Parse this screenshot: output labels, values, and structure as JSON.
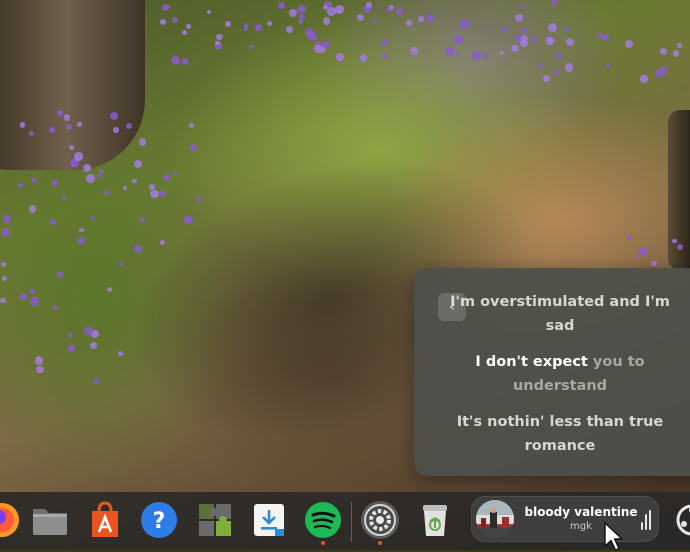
{
  "lyrics": {
    "lines": [
      {
        "text": "I'm overstimulated and I'm sad",
        "state": "past"
      },
      {
        "sung": "I don't expect",
        "unsung": " you to understand",
        "state": "current"
      },
      {
        "text": "It's nothin' less than true romance",
        "state": "next"
      }
    ],
    "collapse_icon": "chevron-left-icon"
  },
  "dock": {
    "apps": [
      {
        "name": "Firefox",
        "icon": "firefox-icon"
      },
      {
        "name": "Files",
        "icon": "folder-icon"
      },
      {
        "name": "App Center",
        "icon": "app-center-icon"
      },
      {
        "name": "Help",
        "icon": "help-icon"
      },
      {
        "name": "Extensions",
        "icon": "puzzle-icon"
      },
      {
        "name": "Software Updater",
        "icon": "download-icon"
      },
      {
        "name": "Spotify",
        "icon": "spotify-icon"
      },
      {
        "name": "Settings",
        "icon": "gear-icon"
      },
      {
        "name": "Trash",
        "icon": "trash-icon"
      },
      {
        "name": "Show Apps",
        "icon": "apps-grid-icon"
      }
    ],
    "media": {
      "title": "bloody valentine",
      "artist": "mgk",
      "visualizer_icon": "audio-bars-icon"
    }
  },
  "colors": {
    "accent": "#e95420",
    "spotify": "#1db954",
    "help": "#2d7de6",
    "app_center": "#e95420",
    "extensions": "#7fae3e",
    "updater": "#2f8bd8",
    "popup_bg": "#4e504a"
  }
}
